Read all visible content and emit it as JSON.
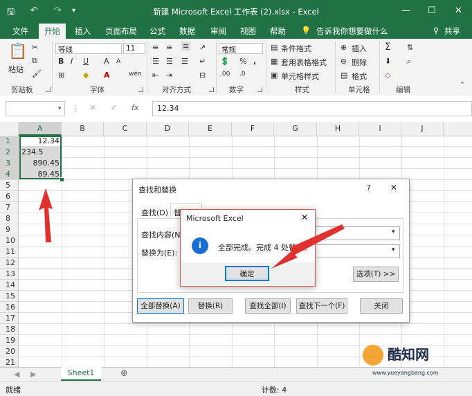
{
  "window": {
    "title": "新建 Microsoft Excel 工作表 (2).xlsx - Excel",
    "controls": [
      "—",
      "☐",
      "✕"
    ]
  },
  "quick_access": {
    "save_icon": "save-icon",
    "undo_icon": "undo-icon",
    "redo_icon": "redo-icon"
  },
  "tabs": [
    "文件",
    "开始",
    "插入",
    "页面布局",
    "公式",
    "数据",
    "审阅",
    "视图",
    "帮助"
  ],
  "tell_me": "告诉我你想要做什么",
  "share": "共享",
  "ribbon": {
    "groups": [
      "剪贴板",
      "字体",
      "对齐方式",
      "数字",
      "样式",
      "单元格",
      "编辑"
    ],
    "paste": "粘贴",
    "font_name": "等线",
    "font_size": "11",
    "number_format": "常规",
    "styles": [
      "条件格式",
      "套用表格格式",
      "单元格样式"
    ],
    "cells": [
      "插入",
      "删除",
      "格式"
    ]
  },
  "formula_bar": {
    "name_box": "",
    "fx": "fx",
    "value": "12.34"
  },
  "columns": [
    "A",
    "B",
    "C",
    "D",
    "E",
    "F",
    "G",
    "H",
    "I",
    "J"
  ],
  "rows": [
    "1",
    "2",
    "3",
    "4",
    "5",
    "6",
    "7",
    "8",
    "9",
    "10",
    "11",
    "12",
    "13",
    "14",
    "15",
    "16",
    "17",
    "18",
    "19",
    "20",
    "21"
  ],
  "cells_a": [
    "12.34",
    "234.5",
    "890.45",
    "89.45"
  ],
  "sheet_tab": "Sheet1",
  "status": {
    "ready": "就绪",
    "count": "计数: 4"
  },
  "find_replace": {
    "title": "查找和替换",
    "help": "?",
    "tab_find": "查找(D)",
    "tab_replace": "替换(P)",
    "find_label": "查找内容(N):",
    "replace_label": "替换为(E):",
    "options_button": "选项(T) >>",
    "buttons": [
      "全部替换(A)",
      "替换(R)",
      "查找全部(I)",
      "查找下一个(F)",
      "关闭"
    ]
  },
  "message_box": {
    "title": "Microsoft Excel",
    "message": "全部完成。完成 4 处替换。",
    "ok": "确定",
    "icon": "info-icon"
  },
  "watermark": {
    "text": "酷知网",
    "url": "www.yueyangbang.com"
  },
  "colors": {
    "excel_green": "#217346",
    "arrow_red": "#e0312e",
    "dialog_border_red": "#d9534f"
  }
}
